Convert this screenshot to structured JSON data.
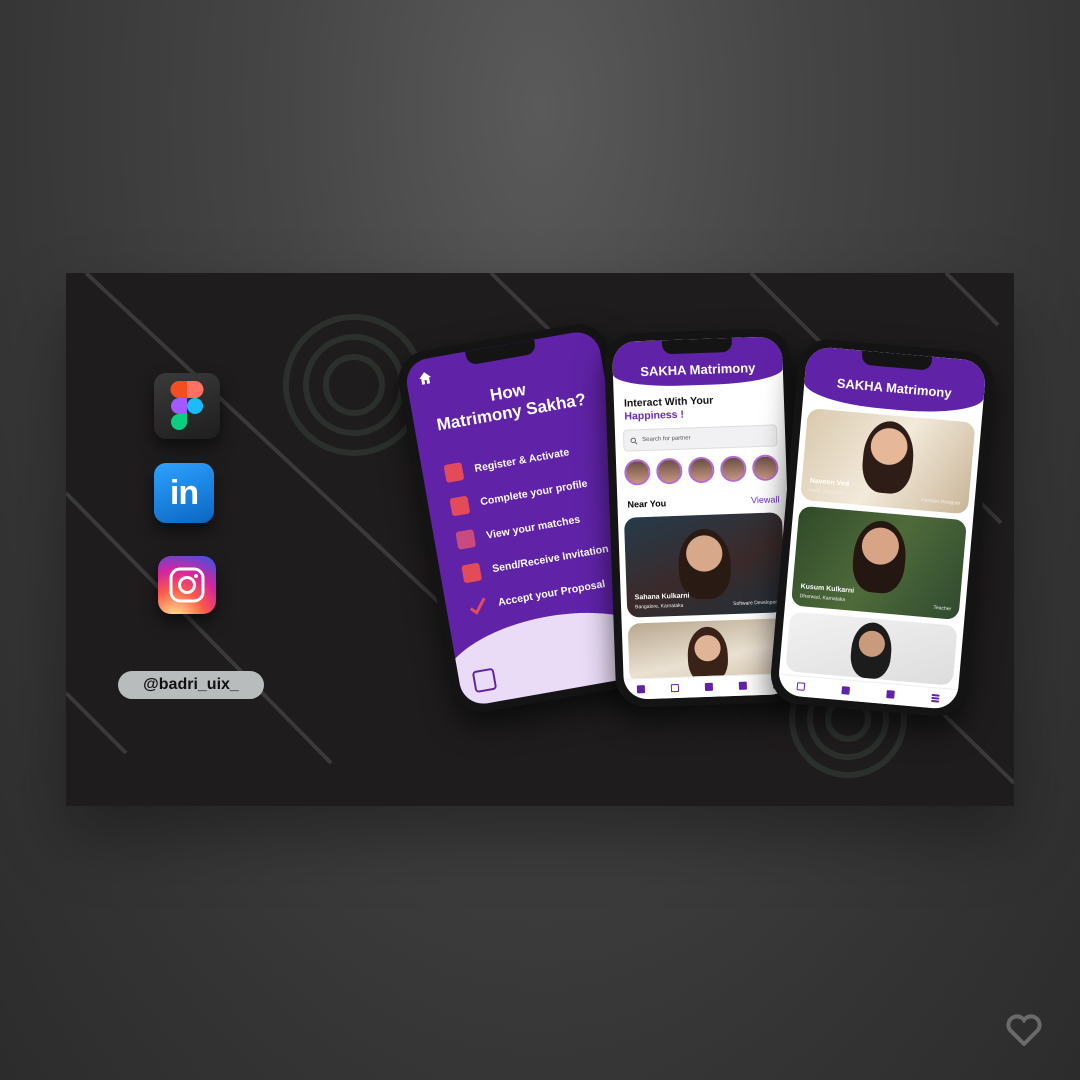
{
  "sidebar": {
    "icons": [
      "figma-icon",
      "linkedin-icon",
      "instagram-icon"
    ],
    "linkedin_text": "in",
    "handle": "@badri_uix_"
  },
  "phone1": {
    "title_line1": "How",
    "title_line2": "Matrimony Sakha?",
    "steps": [
      "Register & Activate",
      "Complete your profile",
      "View your matches",
      "Send/Receive Invitation",
      "Accept your Proposal"
    ]
  },
  "phone2": {
    "brand": "SAKHA Matrimony",
    "heading": "Interact With Your",
    "heading_accent": "Happiness !",
    "search_placeholder": "Search for partner",
    "near_label": "Near You",
    "viewall": "Viewall",
    "cards": [
      {
        "name": "Sahana Kulkarni",
        "meta_left": "Bangalore, Karnataka",
        "meta_right": "Software Developer"
      }
    ]
  },
  "phone3": {
    "brand": "SAKHA Matrimony",
    "cards": [
      {
        "name": "Naveen Ved",
        "meta_left": "Hubli, Karnataka",
        "meta_right": "Fashion Designer"
      },
      {
        "name": "Kusum Kulkarni",
        "meta_left": "Dharwad, Karnataka",
        "meta_right": "Teacher"
      }
    ]
  },
  "colors": {
    "brand_purple": "#6023a8",
    "banner_bg": "#1e1c1c",
    "page_bg": "#3a3a3a"
  }
}
